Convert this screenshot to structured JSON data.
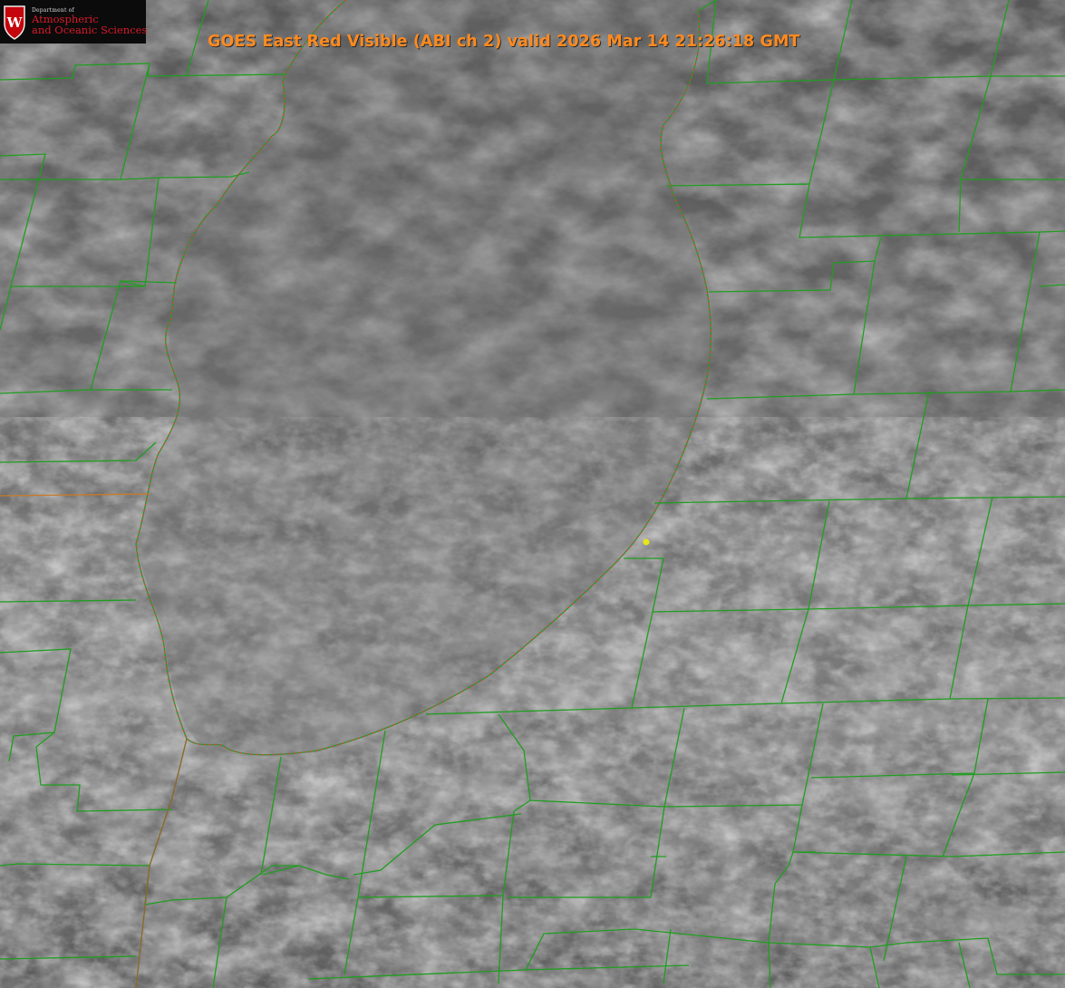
{
  "header": {
    "title": "GOES East Red Visible (ABI ch 2) valid 2026 Mar 14 21:26:18 GMT"
  },
  "logo": {
    "department": "Department of",
    "line1": "Atmospheric",
    "line2": "and Oceanic Sciences",
    "crest_letter": "W"
  },
  "map": {
    "channel": "ABI ch 2",
    "satellite": "GOES East",
    "county_line_color": "#1f9e1f",
    "state_line_color": "#d2423b",
    "marker_color": "#e6e619",
    "background_color": "#5d5d5d"
  }
}
